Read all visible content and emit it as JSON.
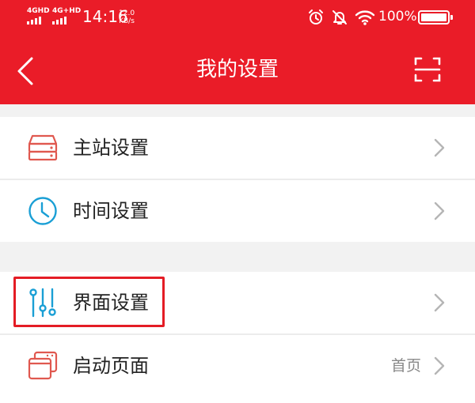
{
  "theme": {
    "accent": "#ea1c28",
    "icon_red": "#e0584f",
    "icon_blue": "#1a9fd5"
  },
  "statusbar": {
    "sim1": "4GHD",
    "sim2": "4G+HD",
    "time": "14:16",
    "speed_value": "12.0",
    "speed_unit": "KB/s",
    "alarm_icon": "alarm-clock-icon",
    "mute_icon": "bell-off-icon",
    "wifi_icon": "wifi-icon",
    "battery_percent": "100%"
  },
  "navbar": {
    "back_icon": "chevron-left-icon",
    "title": "我的设置",
    "scan_icon": "scan-icon"
  },
  "settings": {
    "items": [
      {
        "label": "主站设置",
        "icon": "server-icon",
        "value": ""
      },
      {
        "label": "时间设置",
        "icon": "clock-icon",
        "value": ""
      },
      {
        "label": "界面设置",
        "icon": "sliders-icon",
        "value": ""
      },
      {
        "label": "启动页面",
        "icon": "window-stack-icon",
        "value": "首页"
      }
    ]
  }
}
